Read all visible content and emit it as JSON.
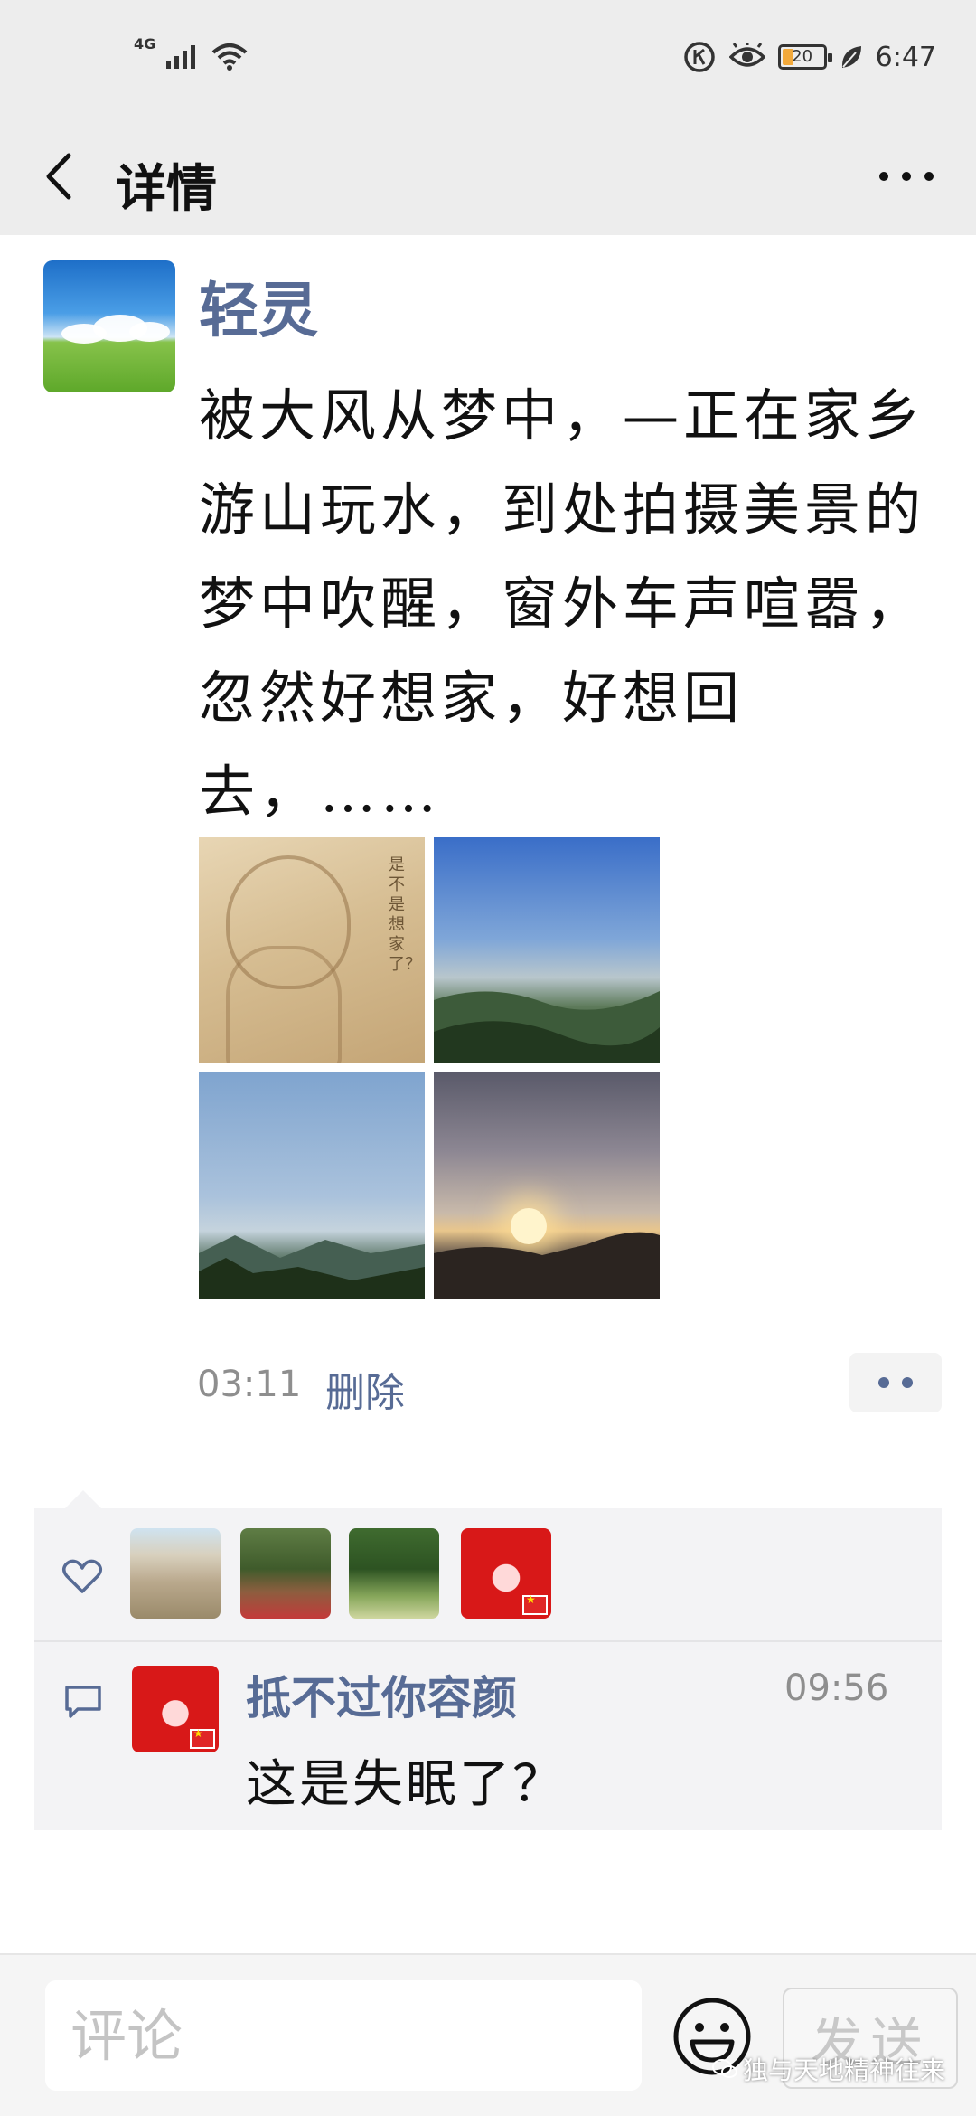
{
  "status_bar": {
    "network": "4G",
    "battery_level": "20",
    "time": "6:47",
    "icons": [
      "signal-icon",
      "wifi-icon",
      "data-saver-icon",
      "eye-comfort-icon",
      "battery-icon",
      "leaf-icon"
    ]
  },
  "nav": {
    "title": "详情",
    "back_icon": "chevron-left-icon",
    "more_icon": "more-icon"
  },
  "post": {
    "author": "轻灵",
    "text": "被大风从梦中，—正在家乡游山玩水，到处拍摄美景的梦中吹醒，窗外车声喧嚣，忽然好想家，好想回去，……",
    "photo_caption_text": "是不是想家了？",
    "time": "03:11",
    "delete_label": "删除"
  },
  "likes": {
    "icon": "heart-icon",
    "count": 4
  },
  "comments": [
    {
      "name": "抵不过你容颜",
      "time": "09:56",
      "text": "这是失眠了？"
    }
  ],
  "input_bar": {
    "placeholder": "评论",
    "send_label": "发送",
    "emoji_icon": "emoji-icon"
  },
  "watermark": "独与天地精神往来",
  "colors": {
    "link_blue": "#576b95",
    "header_bg": "#ededed",
    "comment_bg": "#f3f3f5",
    "battery_fill": "#f2a93b"
  }
}
